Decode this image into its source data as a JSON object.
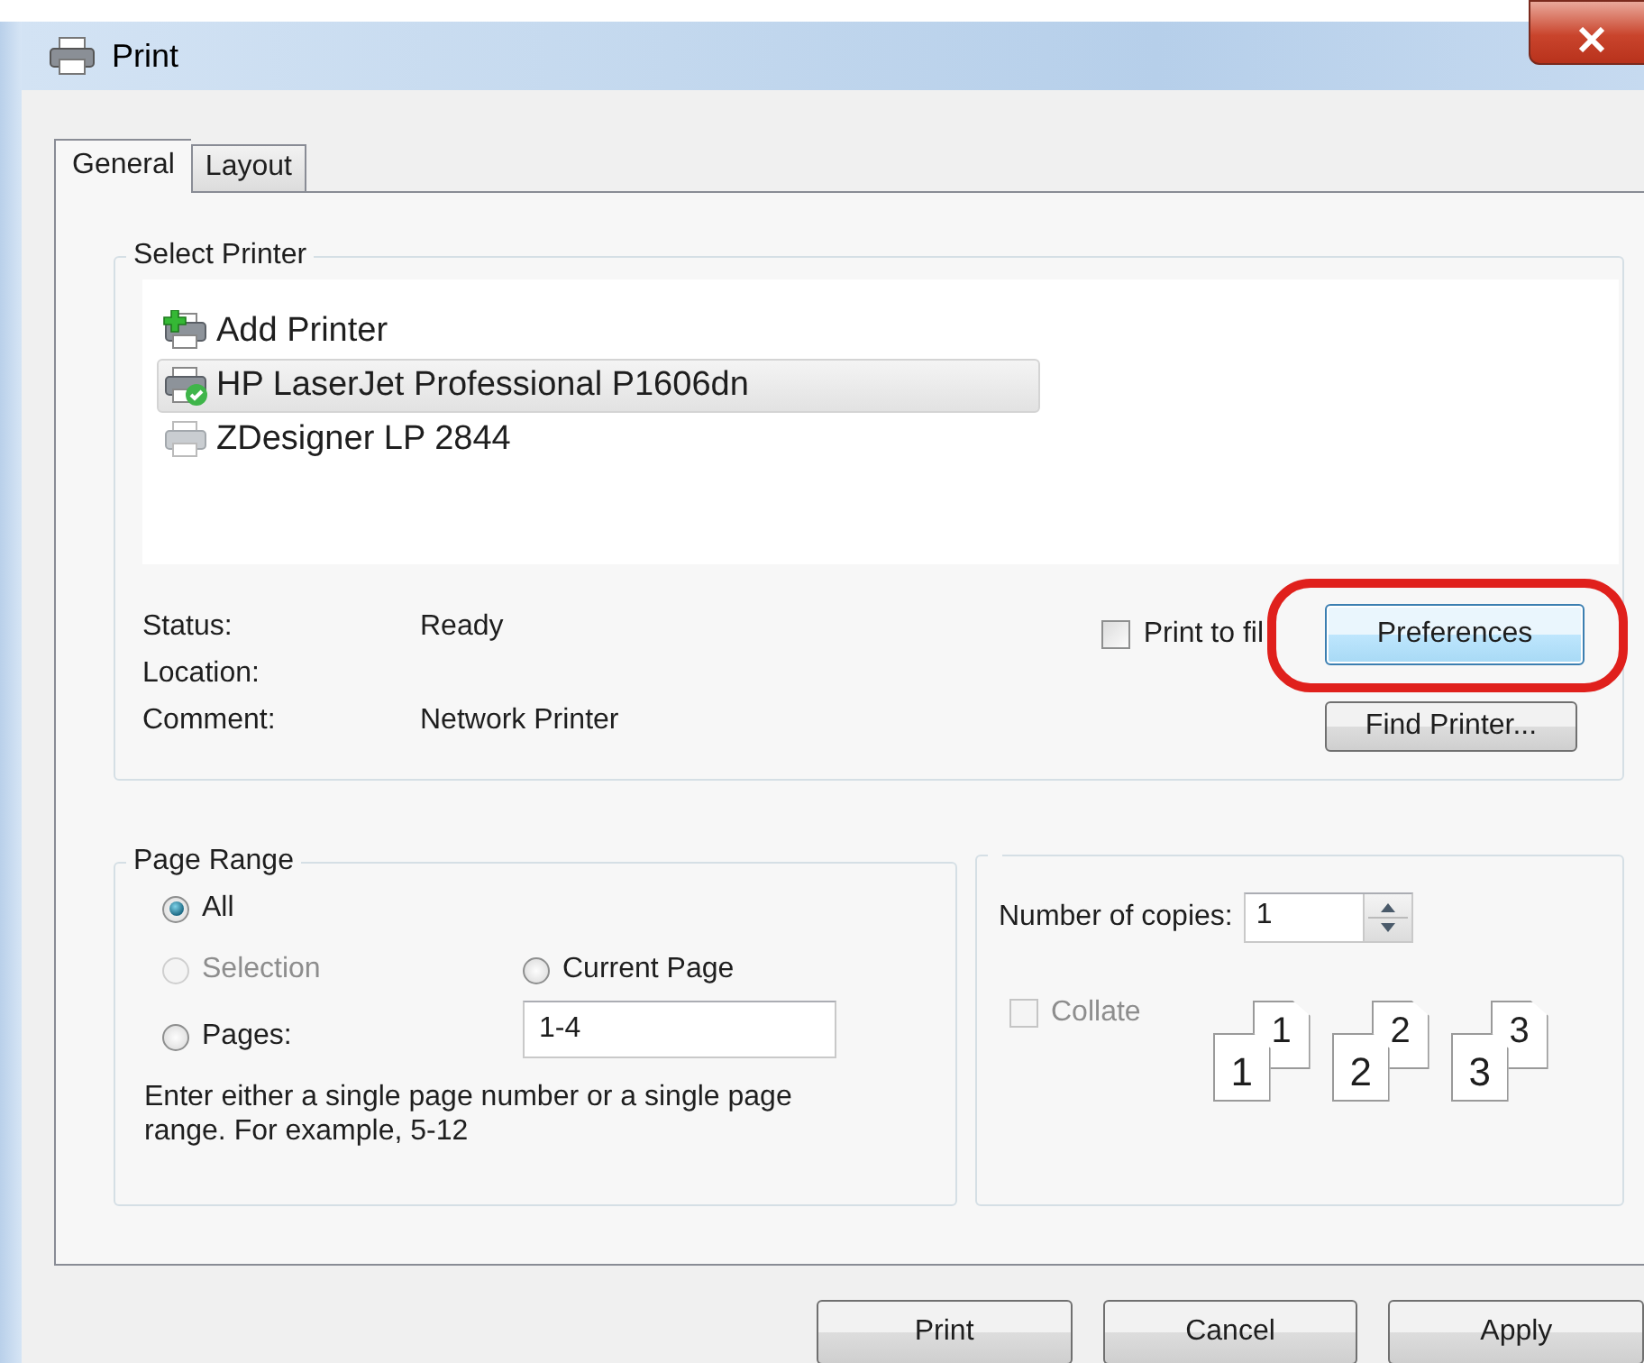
{
  "window": {
    "title": "Print"
  },
  "tabs": [
    {
      "label": "General",
      "selected": true
    },
    {
      "label": "Layout",
      "selected": false
    }
  ],
  "select_printer": {
    "title": "Select Printer",
    "printers": [
      {
        "name": "Add Printer",
        "kind": "add",
        "selected": false
      },
      {
        "name": "HP LaserJet Professional P1606dn",
        "kind": "default",
        "selected": true
      },
      {
        "name": "ZDesigner LP 2844",
        "kind": "printer",
        "selected": false
      }
    ],
    "details": [
      {
        "label": "Status:",
        "value": "Ready"
      },
      {
        "label": "Location:"
      },
      {
        "label": "Comment:",
        "value": "Network Printer"
      }
    ],
    "print_to_file": {
      "label": "Print to fil",
      "checked": false
    },
    "buttons": [
      {
        "label": "Preferences",
        "focused": true,
        "circled": true
      },
      {
        "label": "Find Printer...",
        "focused": false,
        "circled": false
      }
    ]
  },
  "page_range": {
    "title": "Page Range",
    "options": [
      {
        "label": "All",
        "selected": true,
        "disabled": false
      },
      {
        "label": "Selection",
        "selected": false,
        "disabled": true
      },
      {
        "label": "Current Page",
        "selected": false,
        "disabled": false
      },
      {
        "label": "Pages:",
        "selected": false,
        "disabled": false
      }
    ],
    "pages_value": "1-4",
    "hint": "Enter either a single page number or a single page range.  For example, 5-12"
  },
  "copies": {
    "label": "Number of copies:",
    "value": "1",
    "collate": {
      "label": "Collate",
      "checked": false,
      "disabled": true
    },
    "sets": [
      {
        "back": "1",
        "front": "1"
      },
      {
        "back": "2",
        "front": "2"
      },
      {
        "back": "3",
        "front": "3"
      }
    ]
  },
  "footer_buttons": [
    "Print",
    "Cancel",
    "Apply"
  ]
}
